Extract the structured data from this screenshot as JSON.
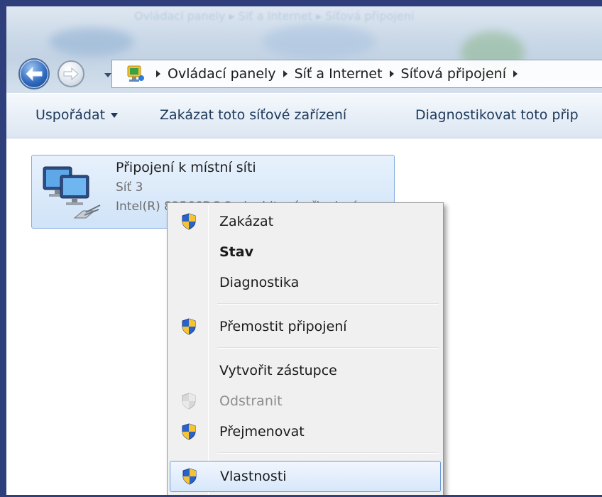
{
  "addressbar": {
    "glass_text": "Ovládací panely ▸ Síť a Internet ▸ Síťová připojení",
    "breadcrumbs": [
      "Ovládací panely",
      "Síť a Internet",
      "Síťová připojení"
    ]
  },
  "toolbar": {
    "organize_label": "Uspořádat",
    "disable_label": "Zakázat toto síťové zařízení",
    "diagnose_label": "Diagnostikovat toto přip"
  },
  "connection": {
    "name": "Připojení k místní síti",
    "network": "Síť 3",
    "adapter": "Intel(R) 82566DC-2 gigabitové připojení"
  },
  "context_menu": {
    "items": [
      {
        "label": "Zakázat",
        "icon": "uac-shield-icon",
        "style": "normal"
      },
      {
        "label": "Stav",
        "icon": "",
        "style": "bold"
      },
      {
        "label": "Diagnostika",
        "icon": "",
        "style": "normal"
      },
      {
        "label": "Přemostit připojení",
        "icon": "uac-shield-icon",
        "style": "normal"
      },
      {
        "label": "Vytvořit zástupce",
        "icon": "",
        "style": "normal"
      },
      {
        "label": "Odstranit",
        "icon": "uac-shield-icon",
        "style": "disabled"
      },
      {
        "label": "Přejmenovat",
        "icon": "uac-shield-icon",
        "style": "normal"
      },
      {
        "label": "Vlastnosti",
        "icon": "uac-shield-icon",
        "style": "highlighted"
      }
    ]
  },
  "colors": {
    "frame": "#2e3f7c",
    "command_text": "#1e395b",
    "menu_background": "#f0f0f0",
    "highlight_border": "#6f9ad6"
  }
}
